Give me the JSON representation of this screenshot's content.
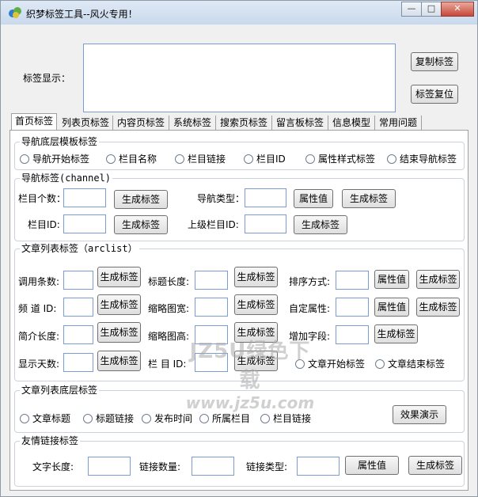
{
  "window": {
    "title": "织梦标签工具--风火专用！",
    "icon": "app-icon",
    "controls": {
      "minimize": "—",
      "maximize": "□",
      "close": "✕"
    }
  },
  "display": {
    "label": "标签显示：",
    "value": "",
    "copy_button": "复制标签",
    "reset_button": "标签复位"
  },
  "tabs": [
    "首页标签",
    "列表页标签",
    "内容页标签",
    "系统标签",
    "搜索页标签",
    "留言板标签",
    "信息模型",
    "常用问题"
  ],
  "nav_bottom": {
    "title": "导航底层模板标签",
    "options": [
      "导航开始标签",
      "栏目名称",
      "栏目链接",
      "栏目ID",
      "属性样式标签",
      "结束导航标签"
    ]
  },
  "nav_tag": {
    "title": "导航标签(channel)",
    "col_count_label": "栏目个数：",
    "col_count_value": "",
    "nav_type_label": "导航类型：",
    "nav_type_value": "",
    "col_id_label": "栏目ID:",
    "col_id_value": "",
    "parent_id_label": "上级栏目ID:",
    "parent_id_value": "",
    "generate": "生成标签",
    "attr": "属性值"
  },
  "arclist": {
    "title": "文章列表标签（arclist）",
    "row1": [
      "调用条数:",
      "标题长度:",
      "排序方式:"
    ],
    "row2": [
      "频 道 ID:",
      "缩略图宽:",
      "自定属性:"
    ],
    "row3": [
      "简介长度:",
      "缩略图高:",
      "增加字段:"
    ],
    "row4": [
      "显示天数:",
      "栏 目 ID:"
    ],
    "start_label": "文章开始标签",
    "end_label": "文章结束标签",
    "generate": "生成标签",
    "attr": "属性值"
  },
  "arclist_bottom": {
    "title": "文章列表底层标签",
    "options": [
      "文章标题",
      "标题链接",
      "发布时间",
      "所属栏目",
      "栏目链接"
    ],
    "demo_button": "效果演示"
  },
  "flink": {
    "title": "友情链接标签",
    "text_len_label": "文字长度:",
    "link_count_label": "链接数量:",
    "link_type_label": "链接类型:",
    "attr": "属性值",
    "generate": "生成标签"
  },
  "watermark": {
    "main": "JZ5U绿色下载",
    "sub": "www.jz5u.com"
  },
  "colors": {
    "title_bar": "#c9d9ec",
    "input_border": "#7a9cd3",
    "panel_bg": "#ffffff",
    "window_bg": "#f0f0f0"
  }
}
